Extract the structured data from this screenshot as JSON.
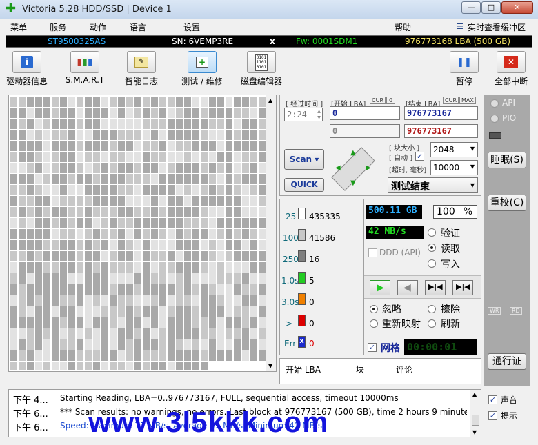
{
  "window": {
    "title": "Victoria 5.28 HDD/SSD | Device 1",
    "min": "—",
    "max": "□",
    "close": "✕"
  },
  "menu": {
    "items": [
      "菜单",
      "服务",
      "动作",
      "语言",
      "设置",
      "帮助"
    ],
    "buffer": "实时查看缓冲区"
  },
  "infobar": {
    "model": "ST9500325AS",
    "sn": "SN: 6VEMP3RE",
    "x": "x",
    "fw": "Fw: 0001SDM1",
    "lba": "976773168 LBA (500 GB)"
  },
  "toolbar": [
    "驱动器信息",
    "S.M.A.R.T",
    "智能日志",
    "测试 / 维修",
    "磁盘编辑器",
    "暂停",
    "全部中断"
  ],
  "scan": {
    "elapsed_label": "[ 经过时间 ]",
    "elapsed": "2:24",
    "start_lba_label": "[开始 LBA]",
    "cur1": "CUR",
    "zero": "0",
    "end_lba_label": "[结束 LBA]",
    "cur2": "CUR",
    "max": "MAX",
    "start_lba": "0",
    "end_lba": "976773167",
    "cur_lba": "0",
    "cur_end": "976773167",
    "scan_btn": "Scan",
    "quick_btn": "QUICK",
    "block_size_label": "[ 块大小 ]",
    "auto_label": "[ 自动 ]",
    "block_size": "2048",
    "timeout_label": "[超时, 毫秒]",
    "timeout": "10000",
    "status": "测试结束"
  },
  "stats": {
    "rows": [
      {
        "label": "25",
        "value": "435335",
        "color": "#ffffff"
      },
      {
        "label": "100",
        "value": "41586",
        "color": "#c8c8c8"
      },
      {
        "label": "250",
        "value": "16",
        "color": "#808080"
      },
      {
        "label": "1.0s",
        "value": "5",
        "color": "#22cc22"
      },
      {
        "label": "3.0s",
        "value": "0",
        "color": "#f08000"
      },
      {
        "label": ">",
        "value": "0",
        "color": "#dd0000"
      },
      {
        "label": "Err",
        "value": "0",
        "color": "#1a2acc"
      }
    ],
    "size": "500.11 GB",
    "percent": "100",
    "percent_sign": "%",
    "speed": "42 MB/s",
    "ddd": "DDD (API)",
    "verify": "验证",
    "read": "读取",
    "write": "写入",
    "ignore": "忽略",
    "erase": "擦除",
    "remap": "重新映射",
    "refresh": "刷新",
    "grid": "网格",
    "timer": "00:00:01"
  },
  "table": {
    "headers": [
      "开始 LBA",
      "块",
      "评论"
    ]
  },
  "side": {
    "api": "API",
    "pio": "PIO",
    "sleep": "睡眠(S)",
    "reset": "重校(C)",
    "wr": "WR",
    "rd": "RD",
    "passport": "通行证"
  },
  "log": [
    {
      "time": "下午 4...",
      "msg": "Starting Reading, LBA=0..976773167, FULL, sequential access, timeout 10000ms"
    },
    {
      "time": "下午 6...",
      "msg": "*** Scan results: no warnings, no errors. Last block at 976773167 (500 GB), time 2 hours 9 minute..."
    },
    {
      "time": "下午 6...",
      "msg": "Speed: Maximum 77 MB/s. Average 59 MB/s. Minimum 42 MB/s."
    }
  ],
  "options": {
    "sound": "声音",
    "hints": "提示"
  },
  "watermark": "www.3l5kkk.com"
}
